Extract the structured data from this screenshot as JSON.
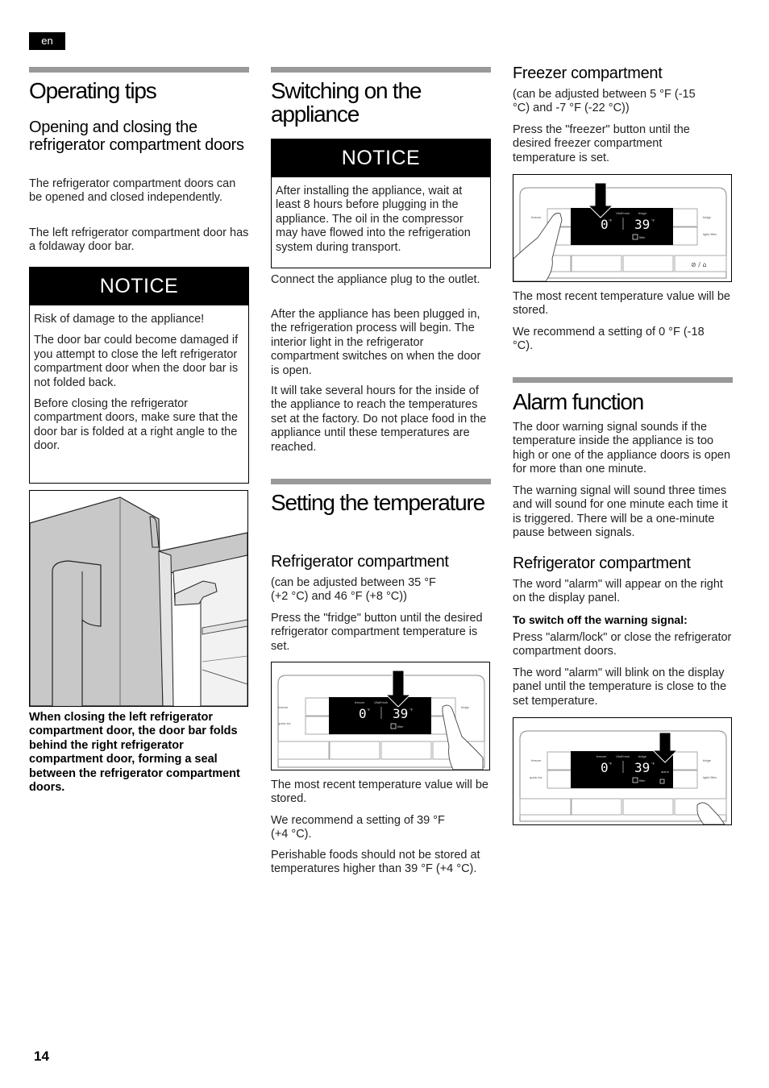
{
  "page": {
    "language_tag": "en",
    "page_number": "14"
  },
  "operating_tips": {
    "title": "Operating tips",
    "subtitle": "Opening and closing the refrigerator compartment doors",
    "para1": "The refrigerator compartment doors can be opened and closed independently.",
    "para2": "The left refrigerator compartment door has a foldaway door bar.",
    "notice": {
      "heading": "NOTICE",
      "lines": [
        "Risk of damage to the appliance!",
        "The door bar could become damaged if you attempt to close the left refrigerator compartment door when the door bar is not folded back.",
        "Before closing the refrigerator compartment doors, make sure that the door bar is folded at a right angle to the door."
      ]
    },
    "figure_caption": "When closing the left refrigerator compartment door, the door bar folds behind the right refrigerator compartment door, forming a seal between the refrigerator compartment doors."
  },
  "switching_on": {
    "title": "Switching on the appliance",
    "notice": {
      "heading": "NOTICE",
      "text": "After installing the appliance, wait at least 8 hours before plugging in the appliance. The oil in the compressor may have flowed into the refrigeration system during transport."
    },
    "para1": "Connect the appliance plug to the outlet.",
    "para2": "After the appliance has been plugged in, the refrigeration process will begin. The interior light in the refrigerator compartment switches on when the door is open.",
    "para3": "It will take several hours for the inside of the appliance to reach the temperatures set at the factory. Do not place food in the appliance until these temperatures are reached."
  },
  "setting_temperature": {
    "title": "Setting the temperature",
    "fridge": {
      "heading": "Refrigerator compartment",
      "range": "(can be adjusted between 35 °F (+2 °C) and 46 °F (+8 °C))",
      "instruction": "Press the \"fridge\" button until the desired refrigerator compartment temperature is set.",
      "stored": "The most recent temperature value will be stored.",
      "recommend": "We recommend a setting of 39 °F (+4 °C).",
      "perishable": "Perishable foods should not be stored at temperatures higher than 39 °F (+4 °C)."
    },
    "freezer": {
      "heading": "Freezer compartment",
      "range": "(can be adjusted between 5 °F (-15 °C) and -7 °F (-22 °C))",
      "instruction": "Press the \"freezer\" button until the desired freezer compartment temperature is set.",
      "stored": "The most recent temperature value will be stored.",
      "recommend": "We recommend a setting of 0 °F (-18 °C)."
    }
  },
  "alarm": {
    "title": "Alarm function",
    "para1": "The door warning signal sounds if the temperature inside the appliance is too high or one of the appliance doors is open for more than one minute.",
    "para2": "The warning signal will sound three times and will sound for one minute each time it is triggered. There will be a one-minute pause between signals.",
    "fridge": {
      "heading": "Refrigerator compartment",
      "para1": "The word \"alarm\" will appear on the right on the display panel.",
      "switch_off_label": "To switch off the warning signal:",
      "para2": "Press \"alarm/lock\" or close the refrigerator compartment doors.",
      "para3": "The word \"alarm\" will blink on the display panel until the temperature is close to the set temperature."
    }
  },
  "control_panel": {
    "left_labels": [
      "freezer",
      "quick ice"
    ],
    "right_labels": [
      "fridge",
      "light/ filter"
    ],
    "display_labels": [
      "freezer",
      "VitaFresh",
      "fridge"
    ],
    "freezer_temp": "0",
    "fridge_temp": "39",
    "unit": "°F",
    "filter_label": "filter",
    "alarm_label": "alarm"
  }
}
